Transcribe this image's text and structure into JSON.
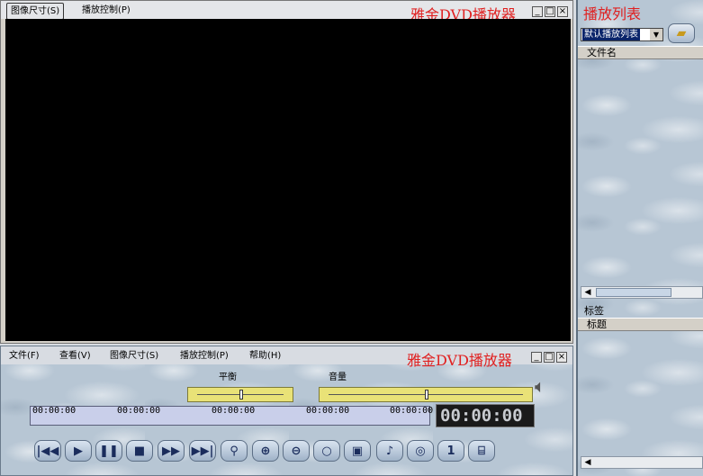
{
  "video_window": {
    "menus": [
      "图像尺寸(S)",
      "播放控制(P)"
    ],
    "brand": "雅金DVD播放器",
    "btn_min": "_",
    "btn_max": "□",
    "btn_close": "×"
  },
  "control_window": {
    "menus": [
      "文件(F)",
      "查看(V)",
      "图像尺寸(S)",
      "播放控制(P)",
      "帮助(H)"
    ],
    "brand": "雅金DVD播放器",
    "balance_label": "平衡",
    "volume_label": "音量",
    "balance_level": 0.5,
    "volume_level": 0.5,
    "timeline_marks": [
      "00:00:00",
      "00:00:00",
      "00:00:00",
      "00:00:00",
      "00:00:00"
    ],
    "time_display": "00:00:00",
    "controls": [
      {
        "name": "previous-track-button",
        "glyph": "|◀◀"
      },
      {
        "name": "play-button",
        "glyph": "▶"
      },
      {
        "name": "pause-button",
        "glyph": "❚❚"
      },
      {
        "name": "stop-button",
        "glyph": "■"
      },
      {
        "name": "fast-forward-button",
        "glyph": "▶▶"
      },
      {
        "name": "next-track-button",
        "glyph": "▶▶|"
      },
      {
        "name": "zoom-button",
        "glyph": "⚲"
      },
      {
        "name": "zoom-in-button",
        "glyph": "⊕"
      },
      {
        "name": "zoom-out-button",
        "glyph": "⊖"
      },
      {
        "name": "search-button",
        "glyph": "○"
      },
      {
        "name": "fullscreen-button",
        "glyph": "▣"
      },
      {
        "name": "audio-button",
        "glyph": "♪"
      },
      {
        "name": "disc-button",
        "glyph": "◎"
      },
      {
        "name": "angle-button",
        "glyph": "1"
      },
      {
        "name": "snapshot-button",
        "glyph": "⌸"
      }
    ]
  },
  "playlist": {
    "title": "播放列表",
    "selected_list": "默认播放列表",
    "column_filename": "文件名",
    "tag_label": "标签",
    "column_title": "标题"
  }
}
